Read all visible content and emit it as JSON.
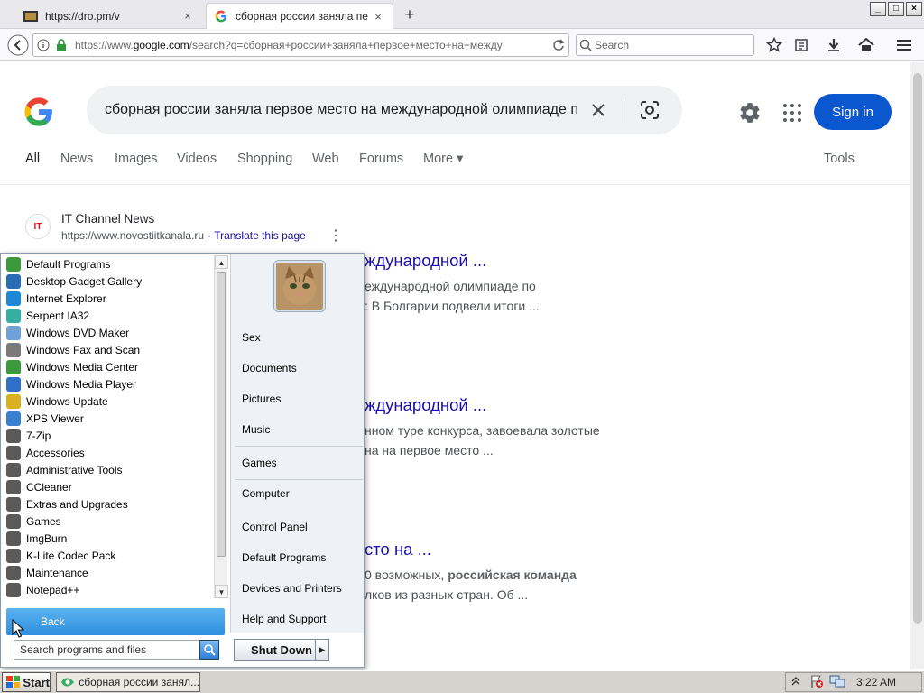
{
  "browser": {
    "tabs": [
      {
        "title": "https://dro.pm/v",
        "close": "×"
      },
      {
        "title": "сборная россии заняла пе",
        "close": "×"
      }
    ],
    "new_tab": "+",
    "window_buttons": {
      "minimize": "_",
      "maximize": "□",
      "close": "×"
    },
    "url_domain_prefix": "https://www.",
    "url_domain": "google.com",
    "url_path": "/search?q=сборная+россии+заняла+первое+место+на+между",
    "search_placeholder": "Search"
  },
  "google": {
    "query": "сборная россии заняла первое место на международной олимпиаде по",
    "sign_in": "Sign in",
    "tabs": [
      "All",
      "News",
      "Images",
      "Videos",
      "Shopping",
      "Web",
      "Forums",
      "More ▾"
    ],
    "tools": "Tools",
    "result_site": {
      "logo_text": "IT",
      "name": "IT Channel News",
      "url": "https://www.novostiitkanala.ru",
      "translate": "· Translate this page",
      "menu": "⋮"
    },
    "results": [
      {
        "title": "ждународной ...",
        "snippet": [
          "еждународной олимпиаде по",
          ": В Болгарии подвели итоги ..."
        ]
      },
      {
        "title": "ждународной ...",
        "snippet": [
          "нном туре конкурса, завоевала золотые",
          "на на первое место ..."
        ]
      },
      {
        "title": "сто на ...",
        "snippet_bold_prefix": "0 возможных, ",
        "snippet_bold": "российская команда",
        "snippet2": "лков из разных стран. Об ..."
      }
    ]
  },
  "start_menu": {
    "programs": [
      {
        "label": "Default Programs",
        "color": "#3c9a3c"
      },
      {
        "label": "Desktop Gadget Gallery",
        "color": "#2a6db5"
      },
      {
        "label": "Internet Explorer",
        "color": "#1e88d8"
      },
      {
        "label": "Serpent IA32",
        "color": "#35b0a0"
      },
      {
        "label": "Windows DVD Maker",
        "color": "#6fa0d8"
      },
      {
        "label": "Windows Fax and Scan",
        "color": "#7a7a7a"
      },
      {
        "label": "Windows Media Center",
        "color": "#3c9a3c"
      },
      {
        "label": "Windows Media Player",
        "color": "#2f6fc8"
      },
      {
        "label": "Windows Update",
        "color": "#d8b020"
      },
      {
        "label": "XPS Viewer",
        "color": "#3a80d0"
      },
      {
        "label": "7-Zip",
        "color": "#5a5a5a"
      },
      {
        "label": "Accessories",
        "color": "#5a5a5a"
      },
      {
        "label": "Administrative Tools",
        "color": "#5a5a5a"
      },
      {
        "label": "CCleaner",
        "color": "#5a5a5a"
      },
      {
        "label": "Extras and Upgrades",
        "color": "#5a5a5a"
      },
      {
        "label": "Games",
        "color": "#5a5a5a"
      },
      {
        "label": "ImgBurn",
        "color": "#5a5a5a"
      },
      {
        "label": "K-Lite Codec Pack",
        "color": "#5a5a5a"
      },
      {
        "label": "Maintenance",
        "color": "#5a5a5a"
      },
      {
        "label": "Notepad++",
        "color": "#5a5a5a"
      }
    ],
    "back": "Back",
    "search_placeholder": "Search programs and files",
    "right_items": [
      {
        "label": "Sex"
      },
      {
        "label": "Documents"
      },
      {
        "label": "Pictures"
      },
      {
        "label": "Music"
      },
      {
        "label": "Games"
      },
      {
        "label": "Computer"
      },
      {
        "label": "Control Panel"
      },
      {
        "label": "Default Programs"
      },
      {
        "label": "Devices and Printers"
      },
      {
        "label": "Help and Support"
      }
    ],
    "shut_down": "Shut Down"
  },
  "taskbar": {
    "start": "Start",
    "task": "сборная россии занял...",
    "clock": "3:22 AM"
  }
}
